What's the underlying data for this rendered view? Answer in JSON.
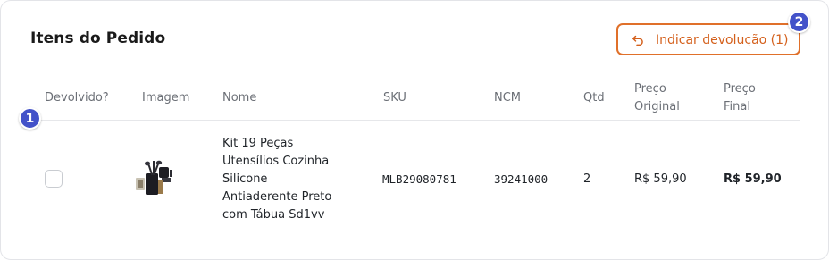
{
  "card": {
    "title": "Itens do Pedido",
    "return_button_label": "Indicar devolução (1)"
  },
  "badges": {
    "first": "1",
    "second": "2"
  },
  "table": {
    "headers": {
      "returned": "Devolvido?",
      "image": "Imagem",
      "name": "Nome",
      "sku": "SKU",
      "ncm": "NCM",
      "qty": "Qtd",
      "original_price_line1": "Preço",
      "original_price_line2": "Original",
      "final_price_line1": "Preço",
      "final_price_line2": "Final"
    },
    "rows": [
      {
        "returned": false,
        "image_icon": "product-thumbnail",
        "name_lines": [
          "Kit 19 Peças",
          "Utensílios Cozinha",
          "Silicone",
          "Antiaderente Preto",
          "com Tábua Sd1vv"
        ],
        "sku": "MLB29080781",
        "ncm": "39241000",
        "qty": "2",
        "original_price": "R$ 59,90",
        "final_price": "R$ 59,90"
      }
    ]
  },
  "colors": {
    "accent": "#e0702a",
    "badge": "#4352c9",
    "header_text": "#6b6f76"
  }
}
